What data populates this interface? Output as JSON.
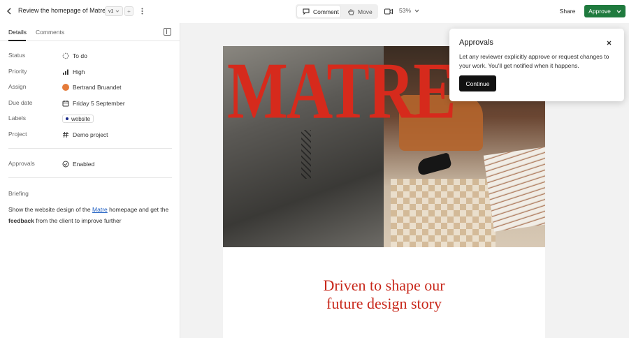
{
  "header": {
    "title": "Review the homepage of Matre",
    "version": "v1",
    "add_version": "+",
    "modes": {
      "comment": "Comment",
      "move": "Move"
    },
    "zoom": "53%",
    "share": "Share",
    "approve": "Approve"
  },
  "panel": {
    "tabs": {
      "details": "Details",
      "comments": "Comments"
    },
    "fields": {
      "status": {
        "label": "Status",
        "value": "To do"
      },
      "priority": {
        "label": "Priority",
        "value": "High"
      },
      "assign": {
        "label": "Assign",
        "value": "Bertrand Bruandet"
      },
      "due": {
        "label": "Due date",
        "value": "Friday 5 September"
      },
      "labels": {
        "label": "Labels",
        "value": "website"
      },
      "project": {
        "label": "Project",
        "value": "Demo project"
      },
      "approvals": {
        "label": "Approvals",
        "value": "Enabled"
      }
    },
    "briefing": {
      "label": "Briefing",
      "part1": "Show the website design of the ",
      "link": "Matre",
      "part2": " homepage and get the ",
      "bold": "feedback",
      "part3": " from the client to improve further"
    }
  },
  "canvas": {
    "logo": "MATRE",
    "tagline_line1": "Driven to shape our",
    "tagline_line2": "future design story"
  },
  "popover": {
    "title": "Approvals",
    "text": "Let any reviewer explicitly approve or request changes to your work. You'll get notified when it happens.",
    "button": "Continue"
  },
  "colors": {
    "approve_green": "#1f7a3e",
    "brand_red": "#d62a1c",
    "link_blue": "#1f5fc2",
    "assignee_avatar": "#e57b3a",
    "label_dot": "#1a2a8a"
  }
}
